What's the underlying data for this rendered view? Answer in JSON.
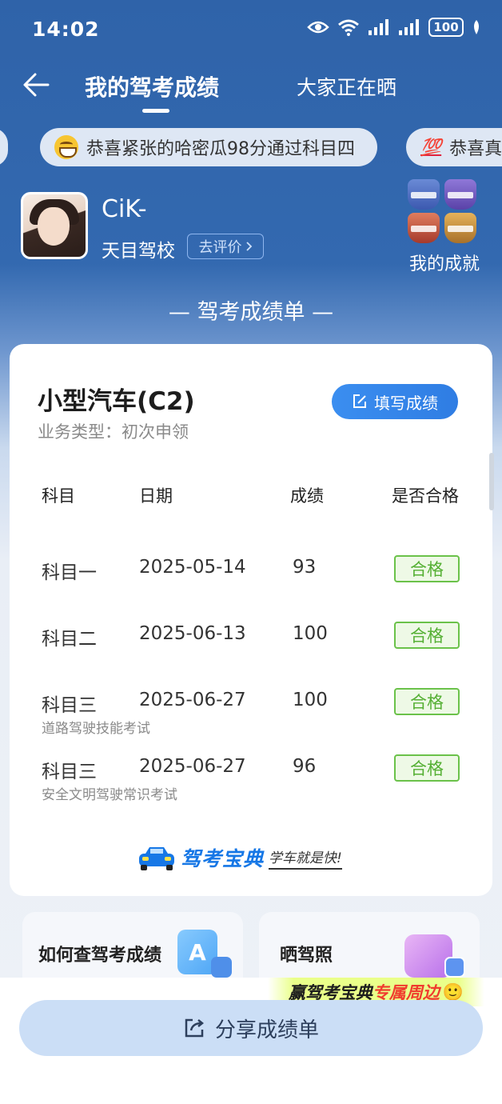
{
  "status_bar": {
    "time": "14:02",
    "battery": "100"
  },
  "nav": {
    "title": "我的驾考成绩",
    "other_tab": "大家正在晒"
  },
  "ticker": {
    "main": "恭喜紧张的哈密瓜98分通过科目四",
    "right_prefix": "💯",
    "right": "恭喜真"
  },
  "profile": {
    "name": "CiK-",
    "school": "天目驾校",
    "review_label": "去评价",
    "achievement_label": "我的成就"
  },
  "section_title": "— 驾考成绩单 —",
  "card": {
    "vehicle": "小型汽车(C2)",
    "business_type": "业务类型：初次申领",
    "fill_button": "填写成绩",
    "headers": [
      "科目",
      "日期",
      "成绩",
      "是否合格"
    ],
    "rows": [
      {
        "subject": "科目一",
        "date": "2025-05-14",
        "score": "93",
        "status": "合格",
        "note": ""
      },
      {
        "subject": "科目二",
        "date": "2025-06-13",
        "score": "100",
        "status": "合格",
        "note": ""
      },
      {
        "subject": "科目三",
        "date": "2025-06-27",
        "score": "100",
        "status": "合格",
        "note": "道路驾驶技能考试"
      },
      {
        "subject": "科目三",
        "date": "2025-06-27",
        "score": "96",
        "status": "合格",
        "note": "安全文明驾驶常识考试"
      }
    ],
    "brand_name": "驾考宝典",
    "brand_slogan": "学车就是快!"
  },
  "tiles": {
    "query": "如何查驾考成绩",
    "license": "晒驾照"
  },
  "promo": {
    "part1": "赢驾考宝典",
    "part2": "专属周边",
    "icon": "🙂"
  },
  "share_button": "分享成绩单",
  "colors": {
    "primary_blue": "#2f63a9",
    "pass_green": "#55b034",
    "accent_blue": "#2f7de3"
  }
}
